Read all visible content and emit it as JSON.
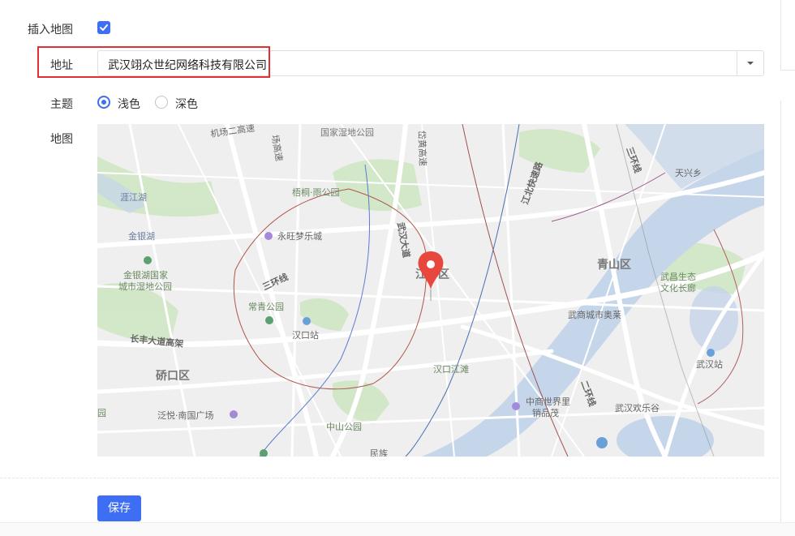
{
  "form": {
    "insert_map_label": "插入地图",
    "insert_map_checked": true,
    "address_label": "地址",
    "address_value": "武汉翊众世纪网络科技有限公司",
    "theme_label": "主题",
    "theme_options": [
      "浅色",
      "深色"
    ],
    "theme_selected": "浅色",
    "map_label": "地图",
    "save_label": "保存"
  },
  "map": {
    "labels": {
      "road_airport2": "机场二高速",
      "road_airport_high": "场高速",
      "park_national": "国家湿地公园",
      "road_yuejiazui": "岱黄高速",
      "park_wutong": "梧桐·雨公园",
      "lake_zhajiang": "涯江湖",
      "lake_jinyin": "金银湖",
      "park_jinyinhu": "金银湖国家",
      "park_jinyinhu2": "城市湿地公园",
      "yongwang": "永旺梦乐城",
      "road_wuhan_ave1": "武汉大道",
      "road_ring3_left": "三环线",
      "park_changqing": "常青公园",
      "hankou_station": "汉口站",
      "district_jiang": "江岸区",
      "road_changfeng": "长丰大道高架",
      "district_qiaokou": "硚口区",
      "fanyue": "泛悦·南国广场",
      "zhongshan_park": "中山公园",
      "jiangtan": "汉口江滩",
      "minzu": "民族",
      "road_jiangbei": "江北快速路",
      "district_qingshan": "青山区",
      "aolai": "武商城市奥莱",
      "eco_corridor1": "武昌生态",
      "eco_corridor2": "文化长廊",
      "tianxing": "天兴乡",
      "road_ring3_right": "三环线",
      "wuhan_station": "武汉站",
      "road_ring2": "二环线",
      "zhongshang": "中商世界里",
      "zhongshang2": "销品茂",
      "happy_valley": "武汉欢乐谷",
      "edge_park": "园",
      "edge_park2": "公园",
      "top_park": "国家湿地公园"
    },
    "colors": {
      "background": "#efefef",
      "water": "#c5d5ea",
      "green": "#cfe6c4",
      "road": "#ffffff",
      "pin": "#e8473d"
    }
  },
  "colors": {
    "accent": "#3d6ef3",
    "highlight": "#e03030"
  },
  "icons": {
    "checkbox": "check-icon",
    "dropdown": "caret-down-icon",
    "map_pin": "map-pin-icon"
  }
}
